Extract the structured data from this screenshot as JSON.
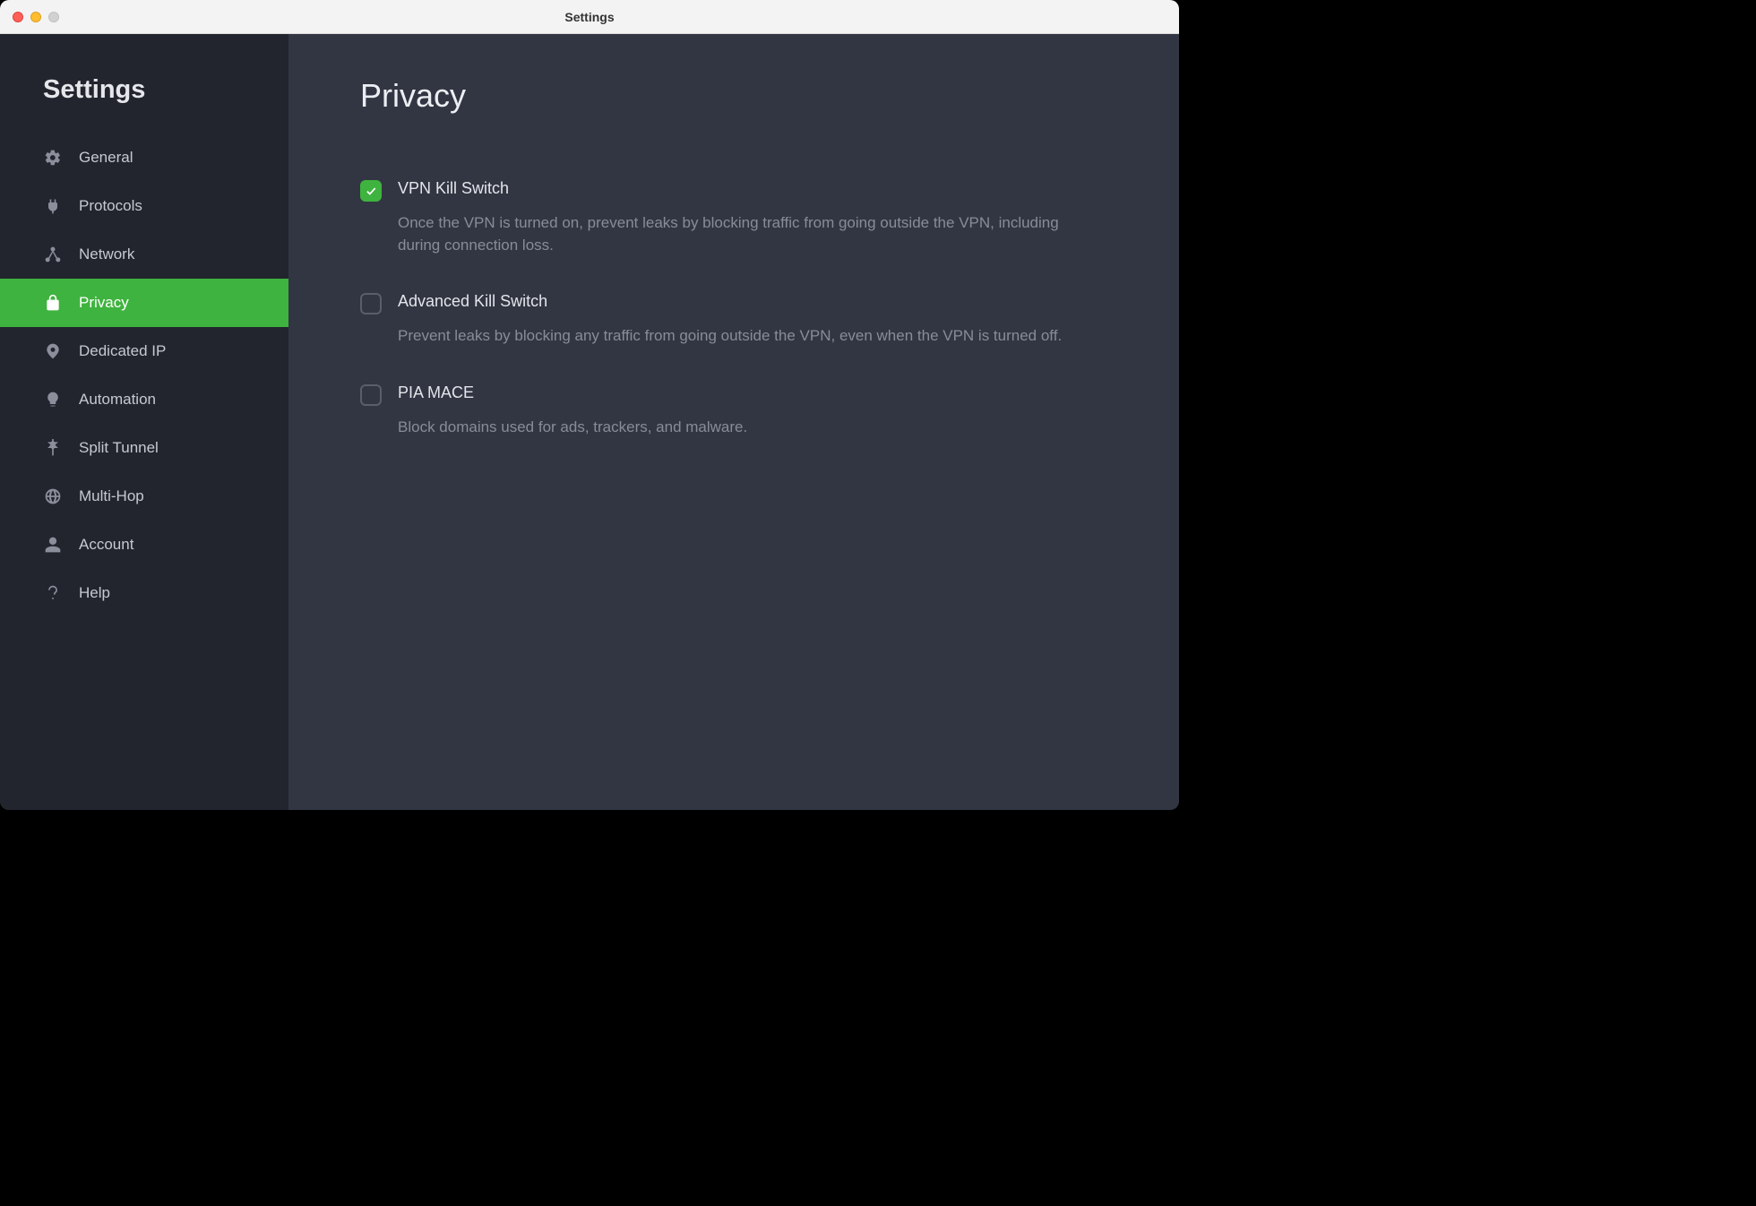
{
  "window": {
    "title": "Settings"
  },
  "sidebar": {
    "heading": "Settings",
    "items": [
      {
        "label": "General",
        "icon": "gear-icon",
        "active": false
      },
      {
        "label": "Protocols",
        "icon": "plug-icon",
        "active": false
      },
      {
        "label": "Network",
        "icon": "network-icon",
        "active": false
      },
      {
        "label": "Privacy",
        "icon": "lock-icon",
        "active": true
      },
      {
        "label": "Dedicated IP",
        "icon": "dedicated-ip-icon",
        "active": false
      },
      {
        "label": "Automation",
        "icon": "lightbulb-icon",
        "active": false
      },
      {
        "label": "Split Tunnel",
        "icon": "split-tunnel-icon",
        "active": false
      },
      {
        "label": "Multi-Hop",
        "icon": "globe-icon",
        "active": false
      },
      {
        "label": "Account",
        "icon": "person-icon",
        "active": false
      },
      {
        "label": "Help",
        "icon": "question-icon",
        "active": false
      }
    ]
  },
  "main": {
    "title": "Privacy",
    "settings": [
      {
        "title": "VPN Kill Switch",
        "description": "Once the VPN is turned on, prevent leaks by blocking traffic from going outside the VPN, including during connection loss.",
        "checked": true
      },
      {
        "title": "Advanced Kill Switch",
        "description": "Prevent leaks by blocking any traffic from going outside the VPN, even when the VPN is turned off.",
        "checked": false
      },
      {
        "title": "PIA MACE",
        "description": "Block domains used for ads, trackers, and malware.",
        "checked": false
      }
    ]
  },
  "colors": {
    "accent": "#3fb33f",
    "sidebar_bg": "#22252e",
    "content_bg": "#323642"
  }
}
